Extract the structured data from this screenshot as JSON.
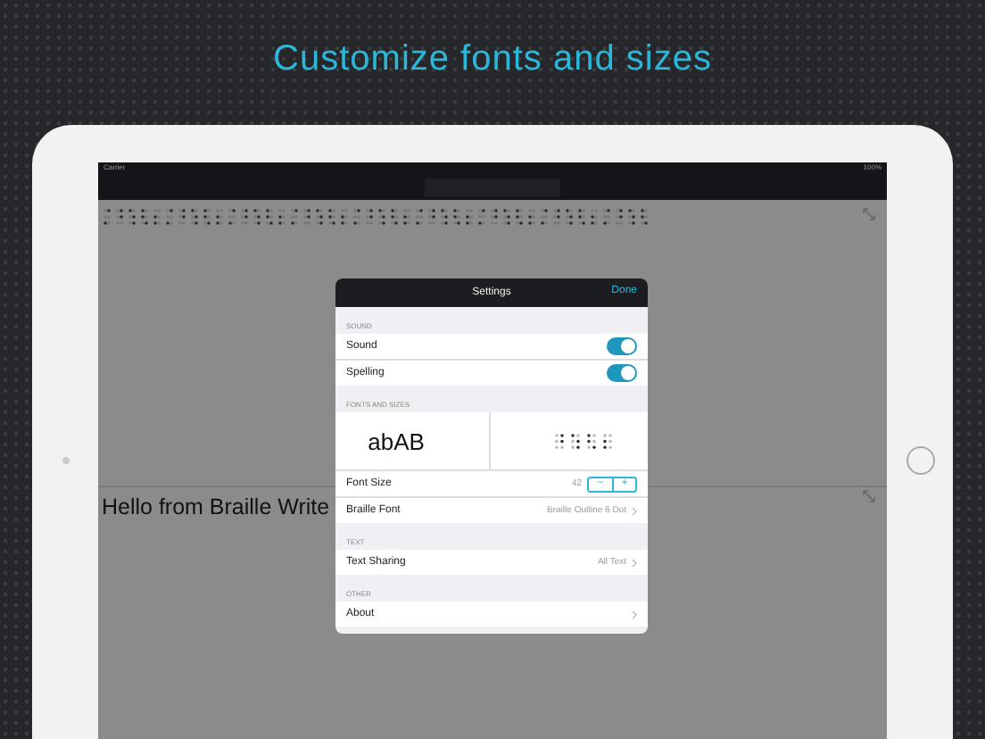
{
  "headline": "Customize fonts and sizes",
  "status_bar": {
    "carrier": "Carrier",
    "battery": "100%"
  },
  "document": {
    "text": "Hello from Braille Write"
  },
  "settings": {
    "title": "Settings",
    "done": "Done",
    "sections": [
      {
        "header": "SOUND",
        "rows": [
          {
            "kind": "toggle",
            "label": "Sound",
            "on": true
          },
          {
            "kind": "toggle",
            "label": "Spelling",
            "on": true
          }
        ]
      },
      {
        "header": "FONTS AND SIZES",
        "rows": [
          {
            "kind": "preview",
            "sample": "abAB"
          },
          {
            "kind": "stepper",
            "label": "Font Size",
            "value": "42",
            "minus": "−",
            "plus": "+"
          },
          {
            "kind": "link",
            "label": "Braille Font",
            "value": "Braille Outline 6 Dot"
          }
        ]
      },
      {
        "header": "TEXT",
        "rows": [
          {
            "kind": "link",
            "label": "Text Sharing",
            "value": "All Text"
          }
        ]
      },
      {
        "header": "OTHER",
        "rows": [
          {
            "kind": "link",
            "label": "About",
            "value": ""
          }
        ]
      }
    ]
  }
}
